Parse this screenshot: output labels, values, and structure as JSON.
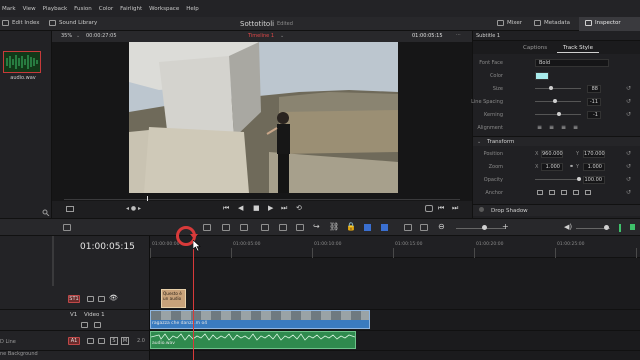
{
  "menubar": {
    "items": [
      "Mark",
      "View",
      "Playback",
      "Fusion",
      "Color",
      "Fairlight",
      "Workspace",
      "Help"
    ]
  },
  "toolbar": {
    "edit_index": "Edit Index",
    "sound_library": "Sound Library",
    "project_title": "Sottotitoli",
    "project_state": "Edited",
    "mixer": "Mixer",
    "metadata": "Metadata",
    "inspector": "Inspector"
  },
  "media_pool": {
    "clip_name": "audio.wav"
  },
  "viewer": {
    "zoom": "35%",
    "source_timecode": "00:00:27:05",
    "timeline_name": "Timeline 1",
    "timecode": "01:00:05:15"
  },
  "inspector": {
    "header": "Subtitle 1",
    "tabs": [
      "Captions",
      "Track Style"
    ],
    "active_tab": "Track Style",
    "font_face_label": "Font Face",
    "font_face_value": "Bold",
    "color_label": "Color",
    "color_value": "#a9ecec",
    "size_label": "Size",
    "size_value": "88",
    "line_spacing_label": "Line Spacing",
    "line_spacing_value": "-11",
    "kerning_label": "Kerning",
    "kerning_value": "-1",
    "alignment_label": "Alignment",
    "transform_title": "Transform",
    "position_label": "Position",
    "position_x": "960.000",
    "position_y": "170.000",
    "zoom_label": "Zoom",
    "zoom_x": "1.000",
    "zoom_y": "1.000",
    "opacity_label": "Opacity",
    "opacity_value": "100.00",
    "anchor_label": "Anchor",
    "drop_shadow": "Drop Shadow",
    "x_label": "X",
    "y_label": "Y"
  },
  "timeline": {
    "timecode": "01:00:05:15",
    "ruler_labels": [
      "01:00:00:00",
      "01:00:05:00",
      "01:00:10:00",
      "01:00:15:00",
      "01:00:20:00",
      "01:00:25:00",
      "01:00:30:00"
    ],
    "tracks": {
      "subtitle_badge": "ST1",
      "video_badge": "V1",
      "video_name": "Video 1",
      "audio_badge": "A1",
      "audio_meta": "2.0",
      "audio_sm": "S",
      "audio_mm": "M"
    },
    "subtitle_clip": "Questo è un audio",
    "video_clip": "ragazza che danza.m o4",
    "audio_clip": "audio.wav",
    "track_bottom_labels": [
      "D Line",
      "ne Background"
    ]
  },
  "colors": {
    "accent_red": "#d83a3a",
    "video_clip": "#3a7bbf",
    "audio_clip": "#2f8a4e",
    "subtitle_clip": "#c8a27a"
  }
}
